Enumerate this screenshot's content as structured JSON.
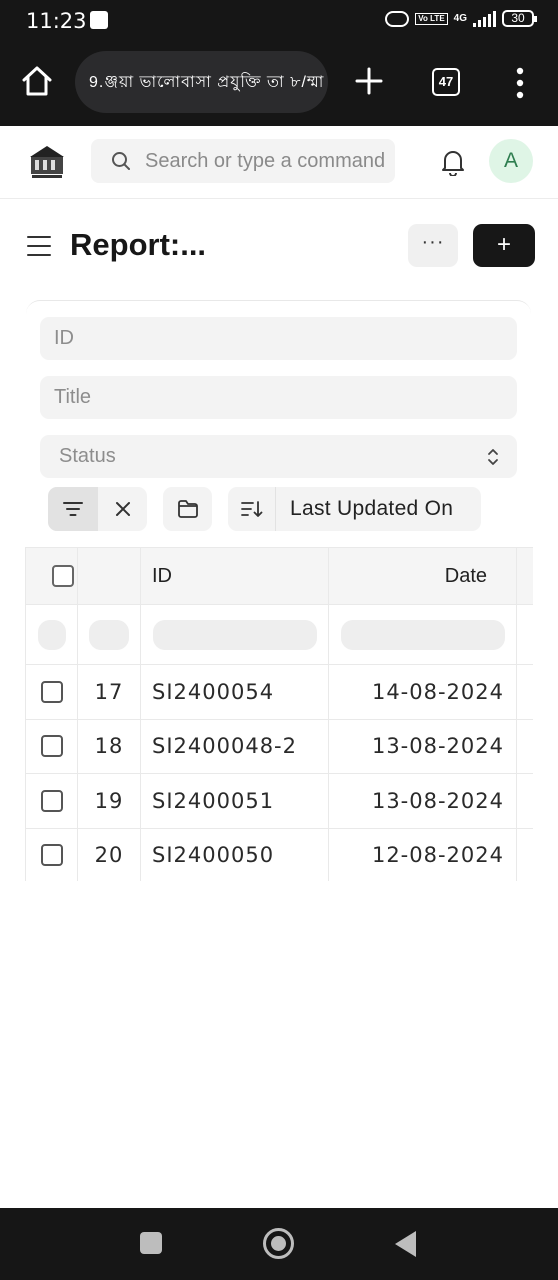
{
  "status_bar": {
    "time": "11:23",
    "network": "4G",
    "volte": "Vo LTE",
    "battery": "30"
  },
  "browser": {
    "url_text": "9.ঞ্জয়া ভালোবাসা প্রযুক্তি তা ৮/ম্মা",
    "tab_count": "47"
  },
  "app_header": {
    "search_placeholder": "Search or type a command",
    "avatar_initial": "A"
  },
  "page": {
    "title": "Report:...",
    "more_label": "···",
    "add_label": "+"
  },
  "filters": {
    "id_placeholder": "ID",
    "title_placeholder": "Title",
    "status_placeholder": "Status"
  },
  "toolbar": {
    "sort_label": "Last Updated On"
  },
  "table": {
    "columns": [
      "ID",
      "Date"
    ],
    "rows": [
      {
        "no": "17",
        "id": "SI2400054",
        "date": "14-08-2024"
      },
      {
        "no": "18",
        "id": "SI2400048-2",
        "date": "13-08-2024"
      },
      {
        "no": "19",
        "id": "SI2400051",
        "date": "13-08-2024"
      },
      {
        "no": "20",
        "id": "SI2400050",
        "date": "12-08-2024"
      }
    ]
  },
  "colors": {
    "dark_bar": "#161616",
    "primary_button": "#171717",
    "input_bg": "#f3f3f3",
    "avatar_bg": "#dff5e6",
    "avatar_text": "#2e7d4f"
  }
}
